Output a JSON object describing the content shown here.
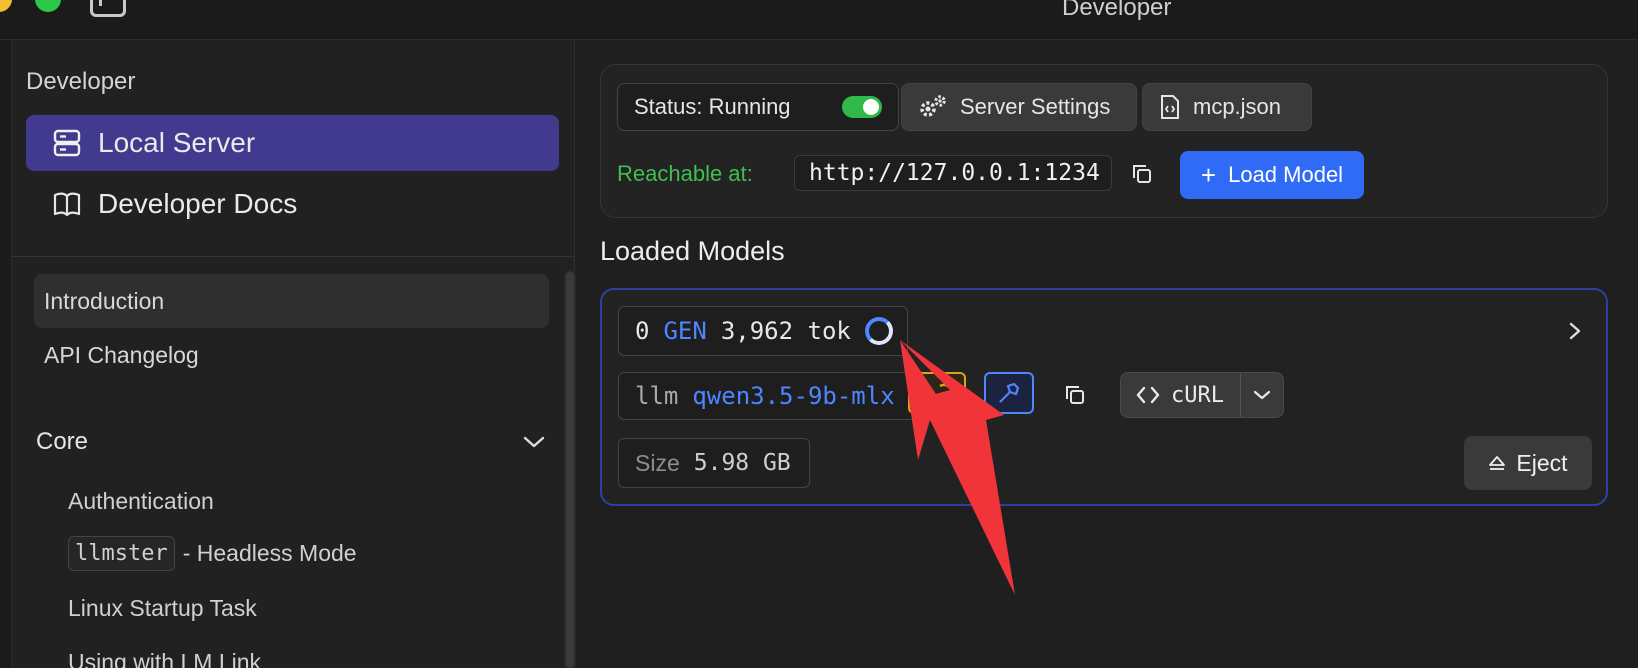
{
  "window": {
    "title": "Developer"
  },
  "sidebar": {
    "heading": "Developer",
    "nav": [
      {
        "label": "Local Server",
        "icon": "server-icon",
        "active": true
      },
      {
        "label": "Developer Docs",
        "icon": "book-icon",
        "active": false
      }
    ],
    "docs": {
      "items": [
        {
          "label": "Introduction",
          "selected": true
        },
        {
          "label": "API Changelog",
          "selected": false
        }
      ],
      "section": {
        "label": "Core",
        "expanded": true
      },
      "subitems": [
        {
          "label": "Authentication"
        },
        {
          "code": "llmster",
          "label": "- Headless Mode"
        },
        {
          "label": "Linux Startup Task"
        },
        {
          "label": "Using with LM Link"
        }
      ]
    }
  },
  "server": {
    "status_label": "Status: Running",
    "running": true,
    "settings_label": "Server Settings",
    "mcp_label": "mcp.json",
    "reachable_label": "Reachable at:",
    "url": "http://127.0.0.1:1234",
    "load_label": "Load Model"
  },
  "loaded_models": {
    "title": "Loaded Models",
    "model": {
      "index": "0",
      "state": "GEN",
      "tokens": "3,962 tok",
      "kind": "llm",
      "name": "qwen3.5-9b-mlx",
      "size_label": "Size",
      "size_value": "5.98 GB",
      "curl_label": "cURL",
      "eject_label": "Eject"
    }
  },
  "colors": {
    "accent": "#2f6bf6",
    "active_nav": "#413a8e",
    "running": "#31b84a",
    "annotation_arrow": "#f0343a"
  }
}
